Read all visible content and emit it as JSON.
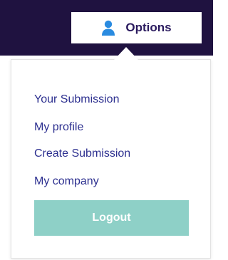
{
  "header": {
    "options_label": "Options",
    "user_icon": "user-icon"
  },
  "menu": {
    "items": [
      {
        "label": "Your Submission"
      },
      {
        "label": "My profile"
      },
      {
        "label": "Create Submission"
      },
      {
        "label": "My company"
      }
    ],
    "logout_label": "Logout"
  },
  "colors": {
    "topbar_bg": "#1f1240",
    "link": "#2c2f8f",
    "icon": "#2a8be0",
    "logout_bg": "#8ed0c7"
  }
}
